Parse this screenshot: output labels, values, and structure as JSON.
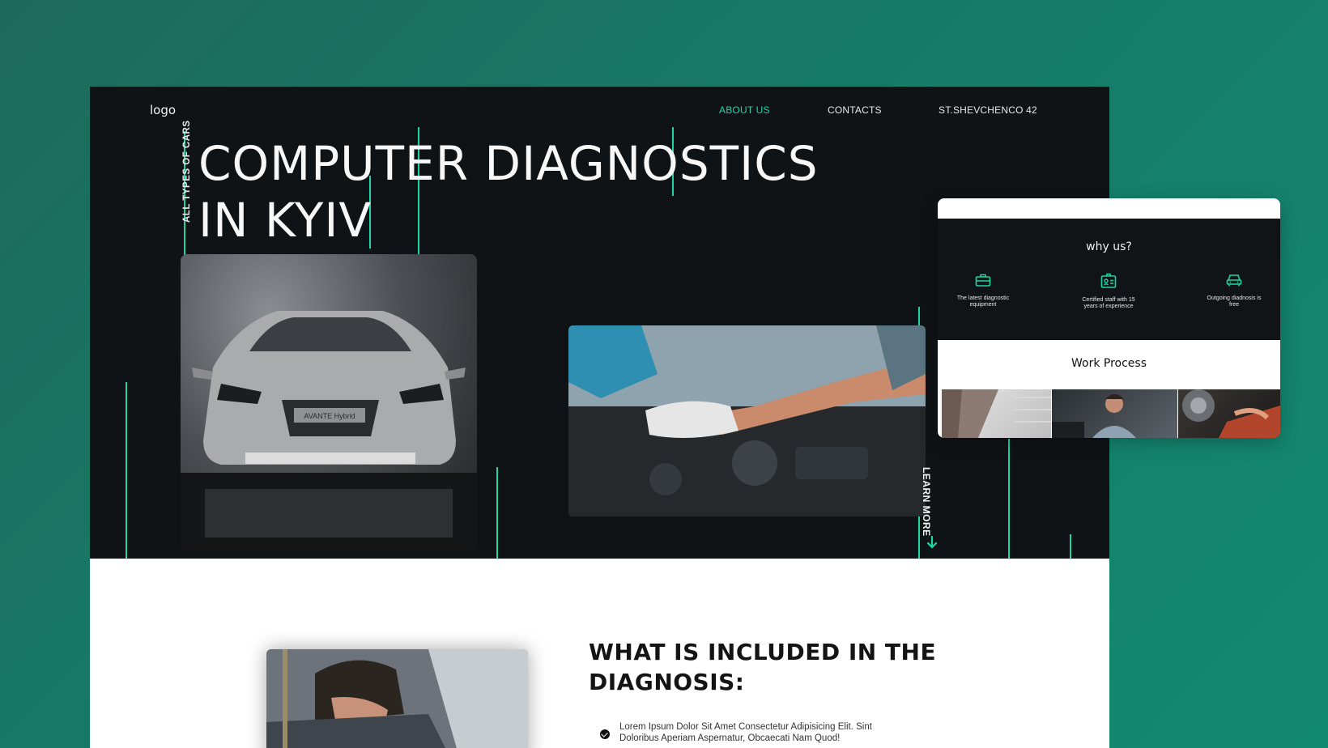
{
  "header": {
    "logo": "logo",
    "nav": [
      "ABOUT US",
      "CONTACTS",
      "ST.SHEVCHENCO 42"
    ]
  },
  "hero": {
    "side_label": "ALL TYPES OF CARS",
    "title_line1": "COMPUTER DIAGNOSTICS",
    "title_line2": "IN KYIV",
    "car_plate": "AVANTE Hybrid",
    "learn_more": "LEARN MORE"
  },
  "included": {
    "title_line1": "WHAT IS INCLUDED IN THE",
    "title_line2": "DIAGNOSIS:",
    "bullet1_line1": "Lorem Ipsum Dolor Sit Amet Consectetur Adipisicing Elit. Sint",
    "bullet1_line2": "Doloribus Aperiam Aspernatur, Obcaecati Nam Quod!"
  },
  "card": {
    "why_title": "why us?",
    "features": [
      {
        "icon": "toolbox-icon",
        "line1": "The latest diagnostic",
        "line2": "equipment"
      },
      {
        "icon": "id-card-icon",
        "line1": "Certified staff with 15",
        "line2": "years of experience"
      },
      {
        "icon": "car-icon",
        "line1": "Outgoing diadnosis is",
        "line2": "free"
      }
    ],
    "work_title": "Work Process"
  },
  "colors": {
    "accent": "#1fd5a6",
    "dark": "#0f1315",
    "background": "#177a68"
  }
}
